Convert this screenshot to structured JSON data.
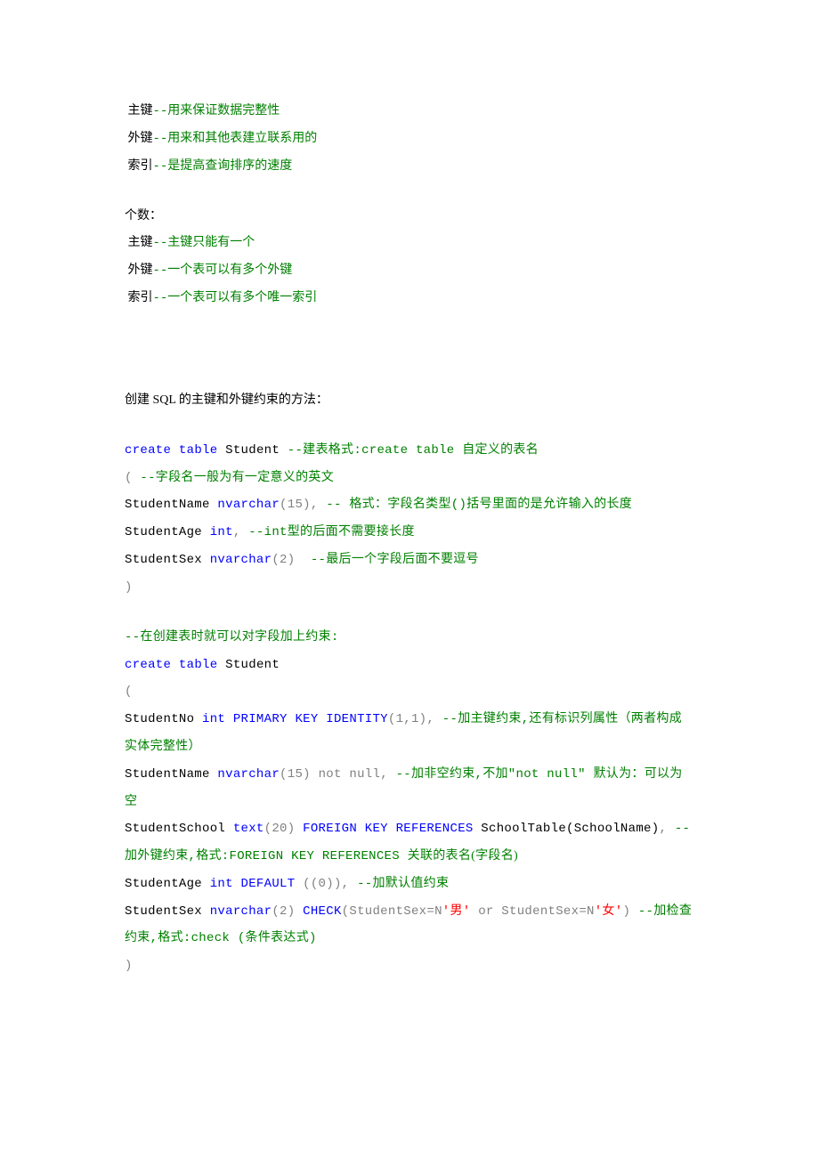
{
  "sec1": {
    "l1a": " 主键",
    "l1b": "--用来保证数据完整性",
    "l2a": " 外键",
    "l2b": "--用来和其他表建立联系用的",
    "l3a": " 索引",
    "l3b": "--是提高查询排序的速度"
  },
  "sec2": {
    "title": "个数：",
    "l1a": " 主键",
    "l1b": "--主键只能有一个",
    "l2a": " 外键",
    "l2b": "--一个表可以有多个外键",
    "l3a": " 索引",
    "l3b": "--一个表可以有多个唯一索引"
  },
  "sec3": {
    "title": "创建 SQL 的主键和外键约束的方法："
  },
  "code1": {
    "l1a": "create",
    "l1b": " table",
    "l1c": " Student ",
    "l1d": "--建表格式:",
    "l1e": "create table ",
    "l1f": "自定义的表名",
    "l2a": "(",
    "l2b": " --字段名一般为有一定意义的英文",
    "l3a": "StudentName ",
    "l3b": "nvarchar",
    "l3c": "(15)",
    "l3d": ",",
    "l3e": " -- 格式：字段名类型()括号里面的是允许输入的长度",
    "l4a": "StudentAge ",
    "l4b": "int",
    "l4c": ",",
    "l4d": " --int型的后面不需要接长度",
    "l5a": "StudentSex ",
    "l5b": "nvarchar",
    "l5c": "(2) ",
    "l5d": " --最后一个字段后面不要逗号",
    "l6": ")"
  },
  "code2": {
    "l0": "--在创建表时就可以对字段加上约束:",
    "l1a": "create",
    "l1b": " table",
    "l1c": " Student",
    "l2": "(",
    "l3a": "StudentNo ",
    "l3b": "int",
    "l3c": " PRIMARY",
    "l3d": " KEY",
    "l3e": " IDENTITY",
    "l3f": "(1,1)",
    "l3g": ",",
    "l3h": " --加主键约束,还有标识列属性（两者构成实体完整性）",
    "l4a": "StudentName ",
    "l4b": "nvarchar",
    "l4c": "(15) ",
    "l4d": "not",
    "l4e": " null",
    "l4f": ",",
    "l4g": " --加非空约束,不加\"not null\" 默认为：可以为空",
    "l5a": "StudentSchool ",
    "l5b": "text",
    "l5c": "(20) ",
    "l5d": "FOREIGN",
    "l5e": " KEY",
    "l5f": " REFERENCES",
    "l5g": " SchoolTable(SchoolName)",
    "l5h": ",",
    "l5i": " --加外键约束,格式:",
    "l5j": "FOREIGN KEY REFERENCES ",
    "l5k": "关联的表名(字段名)",
    "l6a": "StudentAge ",
    "l6b": "int",
    "l6c": " DEFAULT",
    "l6d": " ((0))",
    "l6e": ",",
    "l6f": " --加默认值约束",
    "l7a": "StudentSex ",
    "l7b": "nvarchar",
    "l7c": "(2) ",
    "l7d": "CHECK",
    "l7e": "(StudentSex=N",
    "l7f": "'男'",
    "l7g": " or",
    "l7h": " StudentSex=N",
    "l7i": "'女'",
    "l7j": ")",
    "l7k": " --加检查约束,格式:",
    "l7l": "check (条件表达式)",
    "l8": ")"
  }
}
